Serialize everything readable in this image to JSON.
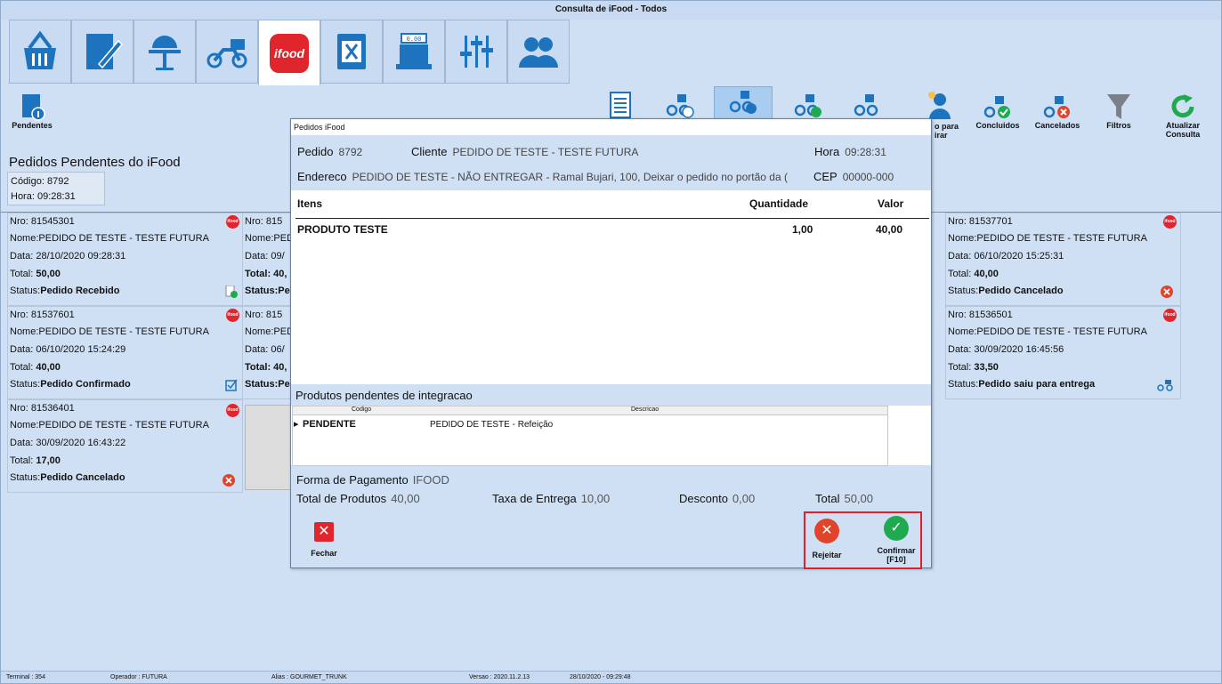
{
  "window": {
    "title": "Consulta de iFood - Todos"
  },
  "modules": [
    {
      "icon": "basket-icon"
    },
    {
      "icon": "notepad-icon"
    },
    {
      "icon": "serving-table-icon"
    },
    {
      "icon": "delivery-motorcycle-icon"
    },
    {
      "icon": "ifood-logo-icon",
      "label": "ifood"
    },
    {
      "icon": "menu-book-icon"
    },
    {
      "icon": "cash-register-icon",
      "display": "0.00"
    },
    {
      "icon": "sliders-icon"
    },
    {
      "icon": "users-icon"
    }
  ],
  "toolbar": {
    "pendentes": "Pendentes",
    "saiu_para_retirar_partial_1": "o para",
    "saiu_para_retirar_partial_2": "irar",
    "concluidos": "Concluidos",
    "cancelados": "Cancelados",
    "filtros": "Filtros",
    "atualizar_1": "Atualizar",
    "atualizar_2": "Consulta"
  },
  "left_panel": {
    "title": "Pedidos Pendentes do iFood",
    "codigo": "Código: 8792",
    "hora": "Hora: 09:28:31"
  },
  "cards": [
    {
      "nro": "Nro:  81545301",
      "nome": "Nome:PEDIDO DE TESTE - TESTE FUTURA",
      "data": "Data:  28/10/2020 09:28:31",
      "total_label": "Total:",
      "total": "50,00",
      "status_label": "Status:",
      "status": "Pedido Recebido",
      "icon": "new-document-icon"
    },
    {
      "nro": "Nro:  81537601",
      "nome": "Nome:PEDIDO DE TESTE - TESTE FUTURA",
      "data": "Data:  06/10/2020 15:24:29",
      "total_label": "Total:",
      "total": "40,00",
      "status_label": "Status:",
      "status": "Pedido Confirmado",
      "icon": "checkbox-icon"
    },
    {
      "nro": "Nro:  81536401",
      "nome": "Nome:PEDIDO DE TESTE - TESTE FUTURA",
      "data": "Data:  30/09/2020 16:43:22",
      "total_label": "Total:",
      "total": "17,00",
      "status_label": "Status:",
      "status": "Pedido Cancelado",
      "icon": "cancel-icon"
    },
    {
      "nro": "Nro:  81537701",
      "nome": "Nome:PEDIDO DE TESTE - TESTE FUTURA",
      "data": "Data:  06/10/2020 15:25:31",
      "total_label": "Total:",
      "total": "40,00",
      "status_label": "Status:",
      "status": "Pedido Cancelado",
      "icon": "cancel-icon"
    },
    {
      "nro": "Nro:  81536501",
      "nome": "Nome:PEDIDO DE TESTE - TESTE FUTURA",
      "data": "Data:  30/09/2020 16:45:56",
      "total_label": "Total:",
      "total": "33,50",
      "status_label": "Status:",
      "status": "Pedido saiu para entrega",
      "icon": "delivery-icon"
    }
  ],
  "partial_cards": [
    {
      "nro": "Nro:  815",
      "nome": "Nome:PED",
      "data": "Data:  09/",
      "total": "Total: 40,",
      "status": "Status:Pe"
    },
    {
      "nro": "Nro:  815",
      "nome": "Nome:PED",
      "data": "Data:  06/",
      "total": "Total: 40,",
      "status": "Status:Pe"
    }
  ],
  "dialog": {
    "title": "Pedidos iFood",
    "pedido_label": "Pedido",
    "pedido": "8792",
    "cliente_label": "Cliente",
    "cliente": "PEDIDO DE TESTE - TESTE FUTURA",
    "hora_label": "Hora",
    "hora": "09:28:31",
    "endereco_label": "Endereco",
    "endereco": "PEDIDO DE TESTE - NÃO ENTREGAR - Ramal Bujari, 100, Deixar o pedido no portão da (",
    "cep_label": "CEP",
    "cep": "00000-000",
    "items_headers": {
      "itens": "Itens",
      "quantidade": "Quantidade",
      "valor": "Valor"
    },
    "items": [
      {
        "nome": "PRODUTO TESTE",
        "quantidade": "1,00",
        "valor": "40,00"
      }
    ],
    "pendentes_title": "Produtos pendentes de integracao",
    "pend_headers": {
      "codigo": "Codigo",
      "descricao": "Descricao"
    },
    "pend_rows": [
      {
        "codigo": "PENDENTE",
        "descricao": "PEDIDO DE TESTE - Refeição"
      }
    ],
    "forma_label": "Forma de Pagamento",
    "forma": "IFOOD",
    "total_produtos_label": "Total de Produtos",
    "total_produtos": "40,00",
    "taxa_label": "Taxa de Entrega",
    "taxa": "10,00",
    "desconto_label": "Desconto",
    "desconto": "0,00",
    "total_label": "Total",
    "total": "50,00",
    "fechar": "Fechar",
    "rejeitar": "Rejeitar",
    "confirmar": "Confirmar",
    "confirmar_key": "[F10]"
  },
  "statusbar": {
    "terminal": "Terminal : 354",
    "operador": "Operador : FUTURA",
    "alias": "Alias : GOURMET_TRUNK",
    "versao": "Versao : 2020.11.2.13",
    "datetime": "28/10/2020 - 09:29:48"
  },
  "colors": {
    "accent_blue": "#1e73be",
    "ifood_red": "#e0252c",
    "green": "#1faa4f"
  }
}
